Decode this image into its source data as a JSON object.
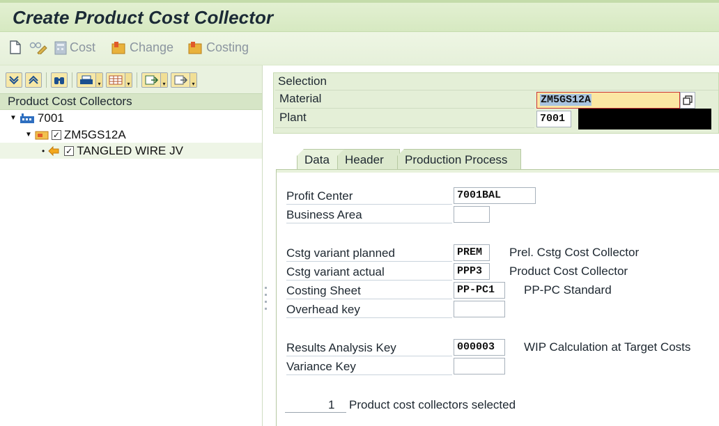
{
  "window": {
    "title": "Create Product Cost Collector"
  },
  "toolbar": {
    "cost_label": "Cost",
    "change_label": "Change",
    "costing_label": "Costing"
  },
  "tree": {
    "header": "Product Cost Collectors",
    "nodes": [
      {
        "label": "7001"
      },
      {
        "label": "ZM5GS12A"
      },
      {
        "label": "TANGLED WIRE JV"
      }
    ]
  },
  "selection": {
    "title": "Selection",
    "material_label": "Material",
    "material_value": "ZM5GS12A",
    "plant_label": "Plant",
    "plant_value": "7001"
  },
  "tabs": [
    {
      "label": "Data",
      "active": true
    },
    {
      "label": "Header",
      "active": false
    },
    {
      "label": "Production Process",
      "active": false
    }
  ],
  "data_tab": {
    "profit_center_label": "Profit Center",
    "profit_center_value": "7001BAL",
    "business_area_label": "Business Area",
    "business_area_value": "",
    "cstg_planned_label": "Cstg variant planned",
    "cstg_planned_value": "PREM",
    "cstg_planned_text": "Prel. Cstg Cost Collector",
    "cstg_actual_label": "Cstg variant actual",
    "cstg_actual_value": "PPP3",
    "cstg_actual_text": "Product Cost Collector",
    "costing_sheet_label": "Costing Sheet",
    "costing_sheet_value": "PP-PC1",
    "costing_sheet_text": "PP-PC Standard",
    "overhead_key_label": "Overhead key",
    "overhead_key_value": "",
    "ra_key_label": "Results Analysis Key",
    "ra_key_value": "000003",
    "ra_key_text": "WIP Calculation at Target Costs",
    "variance_key_label": "Variance Key",
    "variance_key_value": ""
  },
  "footer": {
    "count": "1",
    "count_text": "Product cost collectors selected"
  },
  "colors": {
    "title_bg": "#d6e9c1",
    "required_field": "#fbe7a3",
    "toolbar_button": "#f7e8a7"
  }
}
